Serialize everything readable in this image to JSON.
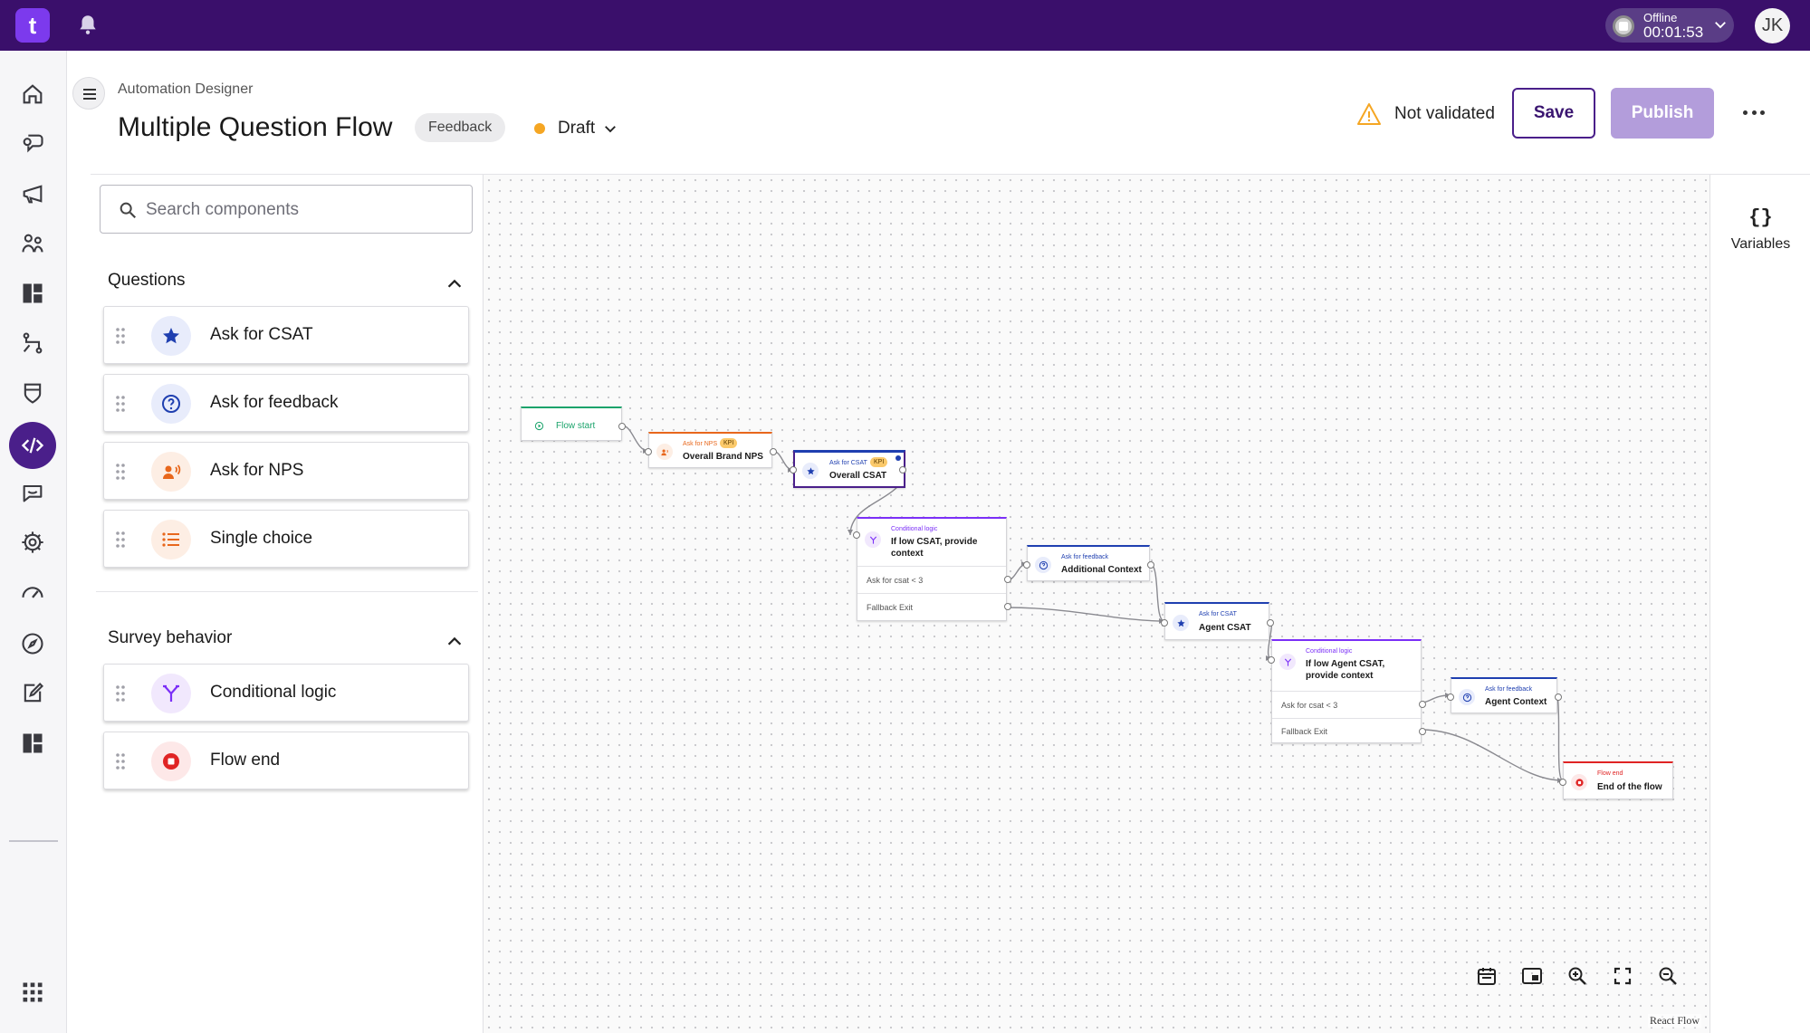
{
  "topbar": {
    "logo_text": "t",
    "status_label": "Offline",
    "status_time": "00:01:53",
    "avatar_initials": "JK"
  },
  "colors": {
    "topbar_bg": "#3a0f6b",
    "accent": "#4a1f8a",
    "publish_disabled": "#b39ddb",
    "draft_dot": "#f5a623",
    "nps_accent": "#e8671c",
    "csat_accent": "#1f3fb0",
    "feedback_accent": "#1f3fb0",
    "logic_accent": "#7b2ff7",
    "end_accent": "#e02424",
    "start_accent": "#1aa36b"
  },
  "rail": {
    "items": [
      "home-icon",
      "conversations-icon",
      "campaigns-icon",
      "audience-icon",
      "dashboard-icon",
      "flows-icon",
      "security-icon",
      "automation-designer-icon",
      "feedback-icon",
      "settings-icon",
      "performance-icon",
      "explore-icon",
      "surveys-icon",
      "reports-icon",
      "apps-grid-icon"
    ],
    "active": "automation-designer-icon"
  },
  "header": {
    "breadcrumb": "Automation Designer",
    "title": "Multiple Question Flow",
    "tag": "Feedback",
    "status": "Draft",
    "validation": "Not validated",
    "save_label": "Save",
    "publish_label": "Publish"
  },
  "panel": {
    "search_placeholder": "Search components",
    "sections": [
      {
        "title": "Questions",
        "items": [
          {
            "label": "Ask for CSAT",
            "icon": "star-icon"
          },
          {
            "label": "Ask for feedback",
            "icon": "question-icon"
          },
          {
            "label": "Ask for NPS",
            "icon": "nps-icon"
          },
          {
            "label": "Single choice",
            "icon": "list-icon"
          }
        ]
      },
      {
        "title": "Survey behavior",
        "items": [
          {
            "label": "Conditional logic",
            "icon": "branch-icon"
          },
          {
            "label": "Flow end",
            "icon": "stop-icon"
          }
        ]
      }
    ]
  },
  "flow": {
    "start": {
      "title": "Flow start"
    },
    "nps": {
      "type": "Ask for NPS",
      "kpi": "KPI",
      "title": "Overall Brand NPS"
    },
    "csat": {
      "type": "Ask for CSAT",
      "kpi": "KPI",
      "title": "Overall CSAT"
    },
    "logic1": {
      "type": "Conditional logic",
      "title": "If low CSAT, provide context",
      "rule": "Ask for csat < 3",
      "fallback": "Fallback Exit"
    },
    "feedback1": {
      "type": "Ask for feedback",
      "title": "Additional Context"
    },
    "agent_csat": {
      "type": "Ask for CSAT",
      "title": "Agent CSAT"
    },
    "logic2": {
      "type": "Conditional logic",
      "title": "If low Agent CSAT, provide context",
      "rule": "Ask for csat < 3",
      "fallback": "Fallback Exit"
    },
    "feedback2": {
      "type": "Ask for feedback",
      "title": "Agent Context"
    },
    "end": {
      "type": "Flow end",
      "title": "End of the flow"
    }
  },
  "canvas": {
    "controls": [
      "calendar-icon",
      "minimap-icon",
      "zoom-in-icon",
      "fit-view-icon",
      "zoom-out-icon"
    ],
    "attribution": "React Flow"
  },
  "right_panel": {
    "icon_text": "{}",
    "label": "Variables"
  }
}
